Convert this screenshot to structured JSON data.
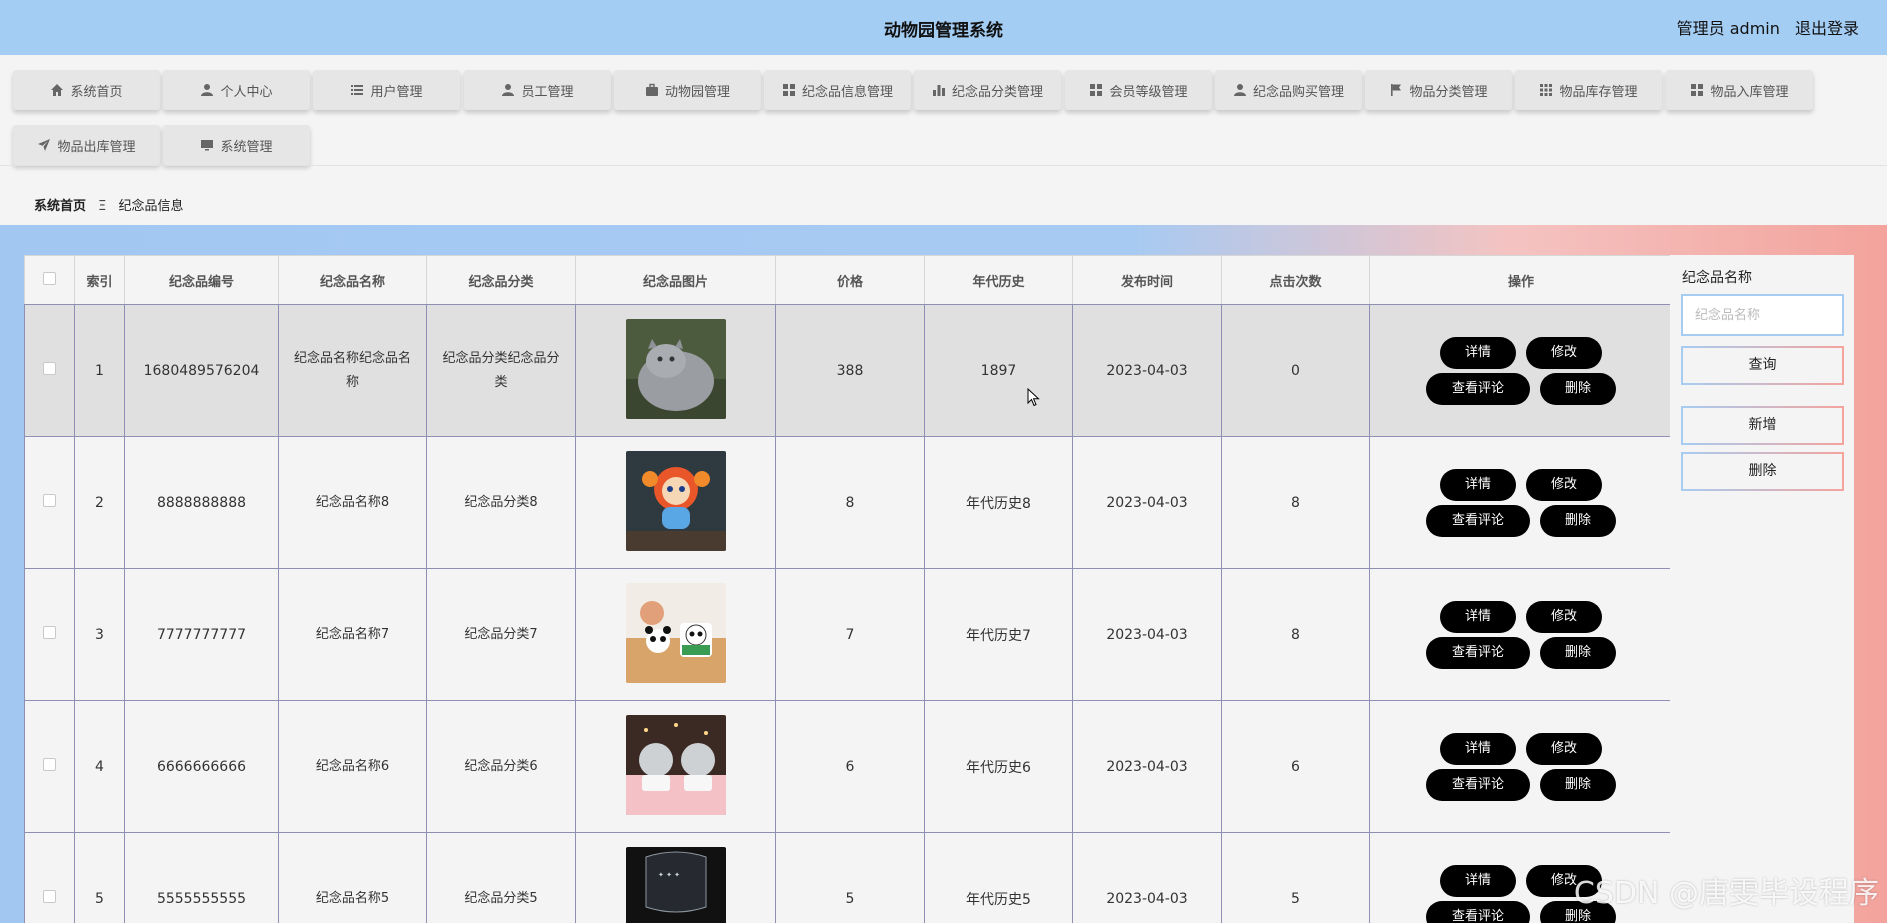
{
  "header": {
    "title": "动物园管理系统",
    "user_label": "管理员 admin",
    "logout_label": "退出登录"
  },
  "nav": [
    {
      "label": "系统首页",
      "icon": "home-icon"
    },
    {
      "label": "个人中心",
      "icon": "person-icon"
    },
    {
      "label": "用户管理",
      "icon": "list-icon"
    },
    {
      "label": "员工管理",
      "icon": "person-icon"
    },
    {
      "label": "动物园管理",
      "icon": "briefcase-icon"
    },
    {
      "label": "纪念品信息管理",
      "icon": "grid-icon"
    },
    {
      "label": "纪念品分类管理",
      "icon": "bar-chart-icon"
    },
    {
      "label": "会员等级管理",
      "icon": "grid-icon"
    },
    {
      "label": "纪念品购买管理",
      "icon": "person-icon"
    },
    {
      "label": "物品分类管理",
      "icon": "flag-icon"
    },
    {
      "label": "物品库存管理",
      "icon": "grid9-icon"
    },
    {
      "label": "物品入库管理",
      "icon": "grid-icon"
    },
    {
      "label": "物品出库管理",
      "icon": "send-icon"
    },
    {
      "label": "系统管理",
      "icon": "monitor-icon"
    }
  ],
  "breadcrumb": {
    "home": "系统首页",
    "separator": "Ξ",
    "current": "纪念品信息"
  },
  "table": {
    "columns": [
      "",
      "索引",
      "纪念品编号",
      "纪念品名称",
      "纪念品分类",
      "纪念品图片",
      "价格",
      "年代历史",
      "发布时间",
      "点击次数",
      "操作"
    ],
    "rows": [
      {
        "index": "1",
        "code": "1680489576204",
        "name": "纪念品名称纪念品名称",
        "category": "纪念品分类纪念品分类",
        "image": "cat-photo",
        "price": "388",
        "history": "1897",
        "date": "2023-04-03",
        "clicks": "0"
      },
      {
        "index": "2",
        "code": "8888888888",
        "name": "纪念品名称8",
        "category": "纪念品分类8",
        "image": "toy-figure-photo",
        "price": "8",
        "history": "年代历史8",
        "date": "2023-04-03",
        "clicks": "8"
      },
      {
        "index": "3",
        "code": "7777777777",
        "name": "纪念品名称7",
        "category": "纪念品分类7",
        "image": "panda-keychain-photo",
        "price": "7",
        "history": "年代历史7",
        "date": "2023-04-03",
        "clicks": "8"
      },
      {
        "index": "4",
        "code": "6666666666",
        "name": "纪念品名称6",
        "category": "纪念品分类6",
        "image": "snow-globe-photo",
        "price": "6",
        "history": "年代历史6",
        "date": "2023-04-03",
        "clicks": "6"
      },
      {
        "index": "5",
        "code": "5555555555",
        "name": "纪念品名称5",
        "category": "纪念品分类5",
        "image": "crystal-trophy-photo",
        "price": "5",
        "history": "年代历史5",
        "date": "2023-04-03",
        "clicks": "5"
      }
    ],
    "ops": {
      "detail": "详情",
      "edit": "修改",
      "comments": "查看评论",
      "delete": "删除"
    }
  },
  "side": {
    "label": "纪念品名称",
    "placeholder": "纪念品名称",
    "query": "查询",
    "add": "新增",
    "delete": "删除"
  },
  "watermark": "CSDN @唐雯毕设程序",
  "colors": {
    "header_bg": "#a4cdf4",
    "button_bg": "#000000",
    "border": "#8f8fb4"
  }
}
